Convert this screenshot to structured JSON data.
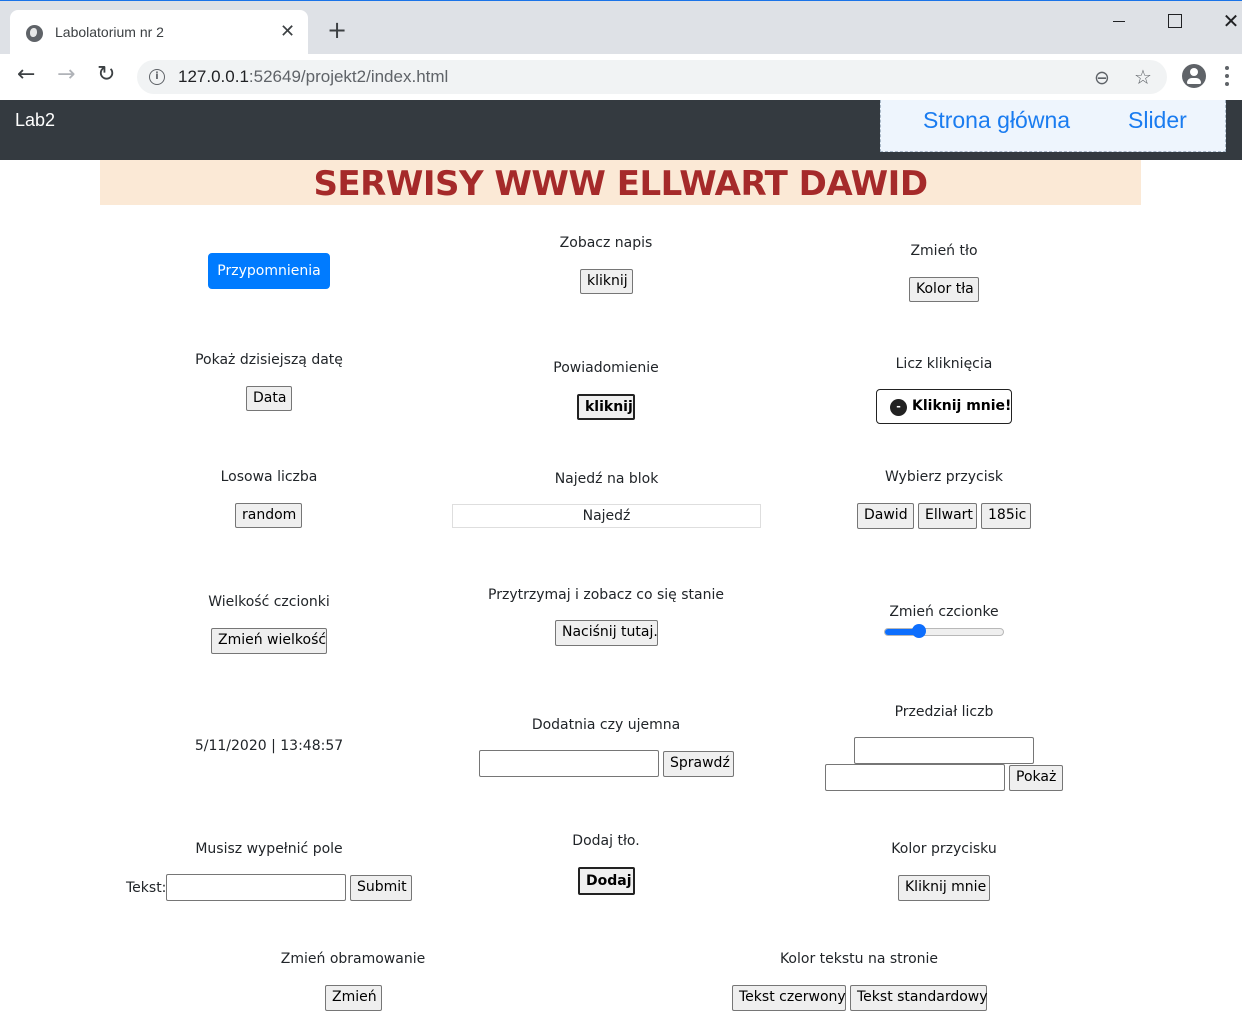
{
  "browser": {
    "tab_title": "Labolatorium nr 2",
    "tab_close": "✕",
    "new_tab": "+",
    "url_host": "127.0.0.1",
    "url_rest": ":52649/projekt2/index.html",
    "back": "←",
    "forward": "→",
    "reload": "↻",
    "info": "i",
    "zoom": "⊖",
    "star": "☆",
    "win_close": "✕",
    "accent_color": "#1a73e8"
  },
  "navbar": {
    "brand": "Lab2",
    "links": [
      "Strona główna",
      "Slider"
    ],
    "background": "#343a40",
    "link_color": "#1a7cf0"
  },
  "banner": {
    "title": "SERWISY WWW ELLWART DAWID",
    "title_color": "#a52a2a",
    "background": "#fbe9d6"
  },
  "cells": {
    "przypomnienia": {
      "button": "Przypomnienia",
      "color": "#007bff"
    },
    "zobacz_napis": {
      "label": "Zobacz napis",
      "button": "kliknij"
    },
    "zmien_tlo": {
      "label": "Zmień tło",
      "button": "Kolor tła"
    },
    "data": {
      "label": "Pokaż dzisiejszą datę",
      "button": "Data"
    },
    "powiadomienie": {
      "label": "Powiadomienie",
      "button": "kliknij"
    },
    "licz": {
      "label": "Licz kliknięcia",
      "counter": "-",
      "button": "Kliknij mnie!"
    },
    "losowa": {
      "label": "Losowa liczba",
      "button": "random"
    },
    "najedz": {
      "label": "Najedź na blok",
      "block": "Najedź"
    },
    "wybierz": {
      "label": "Wybierz przycisk",
      "buttons": [
        "Dawid",
        "Ellwart",
        "185ic"
      ]
    },
    "wielkosc": {
      "label": "Wielkość czcionki",
      "button": "Zmień wielkość"
    },
    "przytrzymaj": {
      "label": "Przytrzymaj i zobacz co się stanie",
      "button": "Naciśnij tutaj."
    },
    "czcionka_slider": {
      "label": "Zmień czcionke",
      "value": 0.29,
      "color": "#0d6efd"
    },
    "zegar": {
      "text": "5/11/2020 | 13:48:57"
    },
    "dodatnia": {
      "label": "Dodatnia czy ujemna",
      "input": "",
      "button": "Sprawdź"
    },
    "przedzial": {
      "label": "Przedział liczb",
      "input1": "",
      "input2": "",
      "button": "Pokaż"
    },
    "wypelnij": {
      "label": "Musisz wypełnić pole",
      "field_label": "Tekst:",
      "input": "",
      "button": "Submit"
    },
    "dodaj_tlo": {
      "label": "Dodaj tło.",
      "button": "Dodaj"
    },
    "kolor_przycisku": {
      "label": "Kolor przycisku",
      "button": "Kliknij mnie"
    },
    "obramowanie": {
      "label": "Zmień obramowanie",
      "button": "Zmień"
    },
    "kolor_tekstu": {
      "label": "Kolor tekstu na stronie",
      "buttons": [
        "Tekst czerwony",
        "Tekst standardowy"
      ]
    }
  }
}
